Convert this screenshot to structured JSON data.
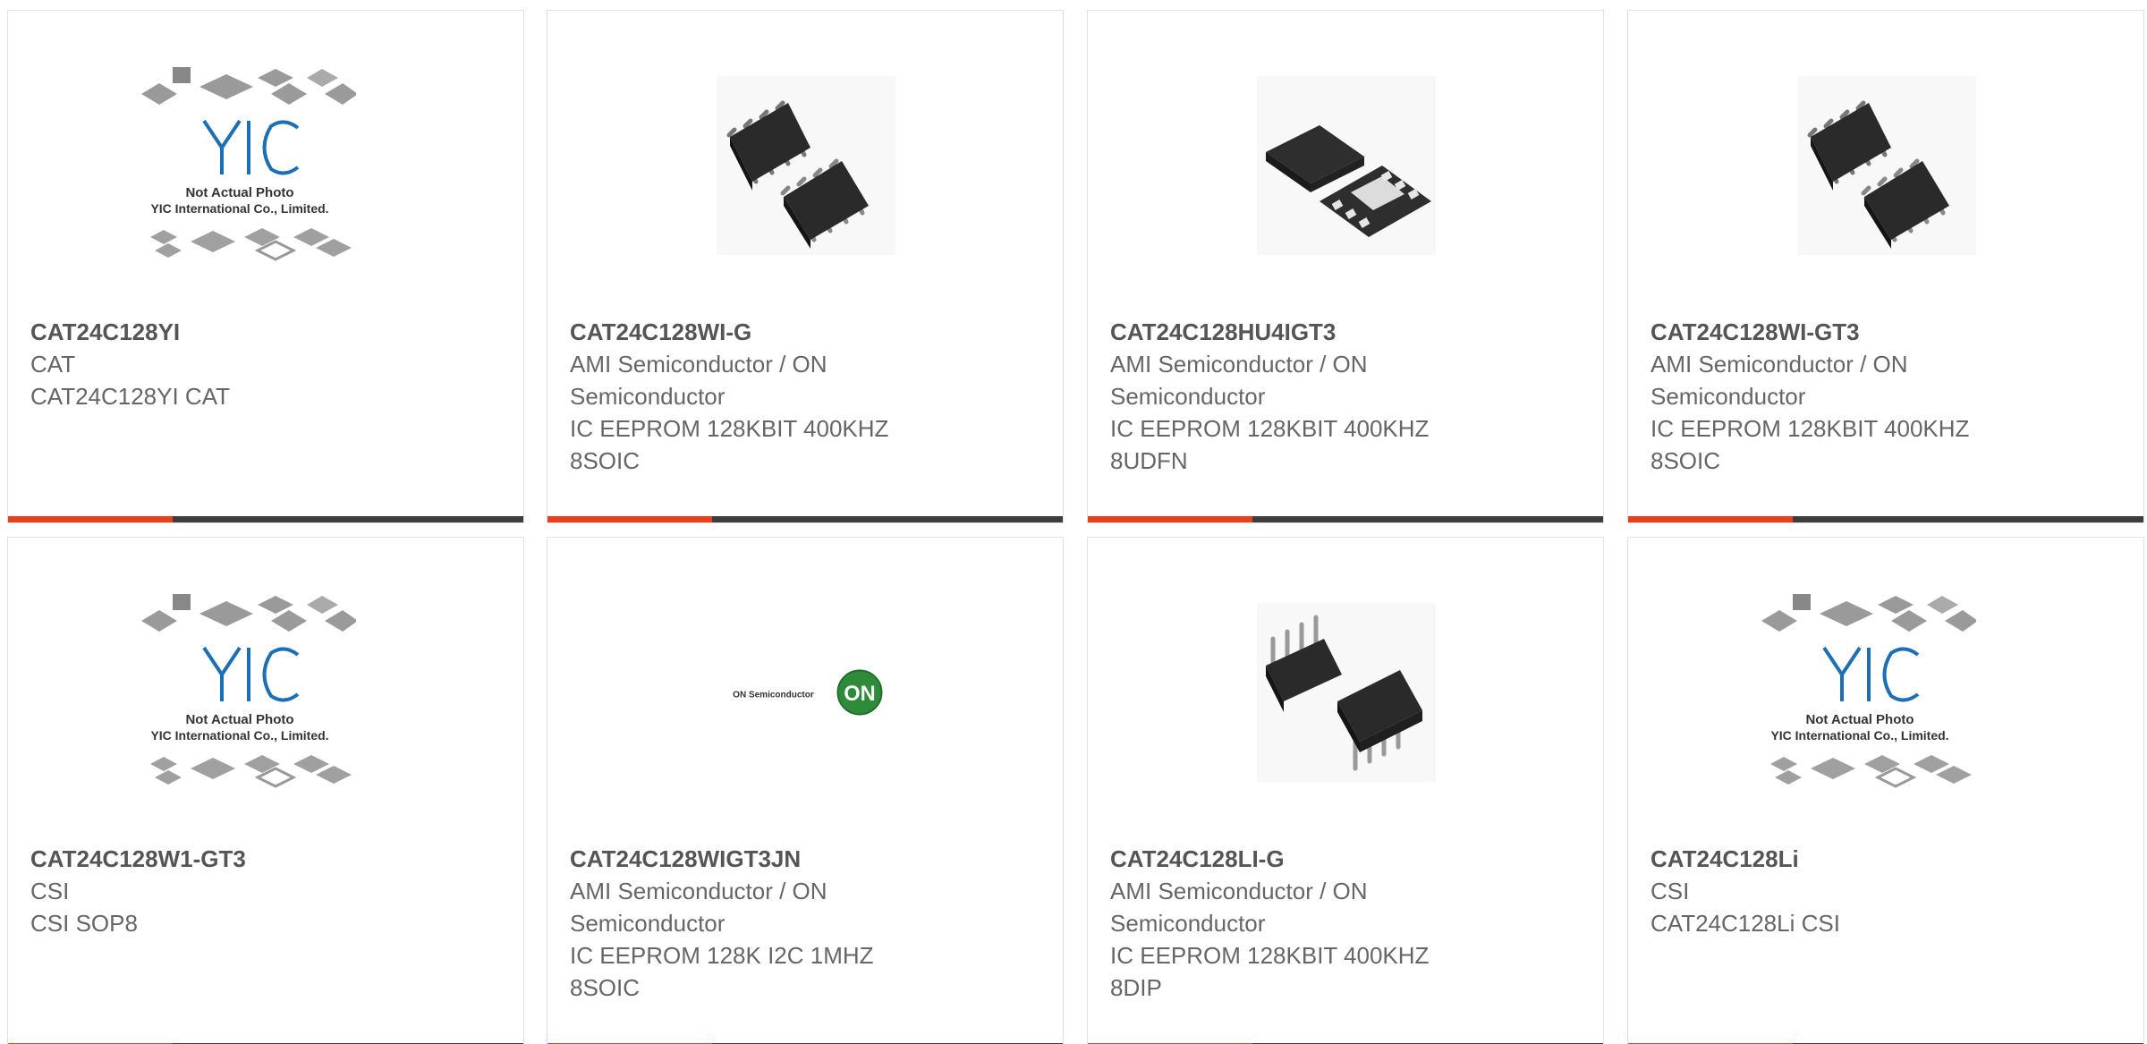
{
  "products": [
    {
      "part": "CAT24C128YI",
      "manufacturer": "CAT",
      "description": "CAT24C128YI CAT",
      "image": "placeholder-not-actual-photo"
    },
    {
      "part": "CAT24C128WI-G",
      "manufacturer": "AMI Semiconductor / ON Semiconductor",
      "description": "IC EEPROM 128KBIT 400KHZ 8SOIC",
      "image": "soic8-chip"
    },
    {
      "part": "CAT24C128HU4IGT3",
      "manufacturer": "AMI Semiconductor / ON Semiconductor",
      "description": "IC EEPROM 128KBIT 400KHZ 8UDFN",
      "image": "udfn8-chip"
    },
    {
      "part": "CAT24C128WI-GT3",
      "manufacturer": "AMI Semiconductor / ON Semiconductor",
      "description": "IC EEPROM 128KBIT 400KHZ 8SOIC",
      "image": "soic8-chip"
    },
    {
      "part": "CAT24C128W1-GT3",
      "manufacturer": "CSI",
      "description": "CSI SOP8",
      "image": "placeholder-not-actual-photo"
    },
    {
      "part": "CAT24C128WIGT3JN",
      "manufacturer": "AMI Semiconductor / ON Semiconductor",
      "description": "IC EEPROM 128K I2C 1MHZ 8SOIC",
      "image": "on-semiconductor-logo"
    },
    {
      "part": "CAT24C128LI-G",
      "manufacturer": "AMI Semiconductor / ON Semiconductor",
      "description": "IC EEPROM 128KBIT 400KHZ 8DIP",
      "image": "dip8-chip"
    },
    {
      "part": "CAT24C128Li",
      "manufacturer": "CSI",
      "description": "CAT24C128Li CSI",
      "image": "placeholder-not-actual-photo"
    }
  ],
  "placeholder": {
    "line1": "Not Actual Photo",
    "line2": "YIC International Co., Limited.",
    "logo": "YIC"
  },
  "on_logo": {
    "wordmark": "ON Semiconductor",
    "badge": "ON"
  },
  "colors": {
    "accent": "#e8401c",
    "bar": "#3d3d3d",
    "logo_blue": "#1b6fb5",
    "on_green": "#2e8b3a"
  }
}
